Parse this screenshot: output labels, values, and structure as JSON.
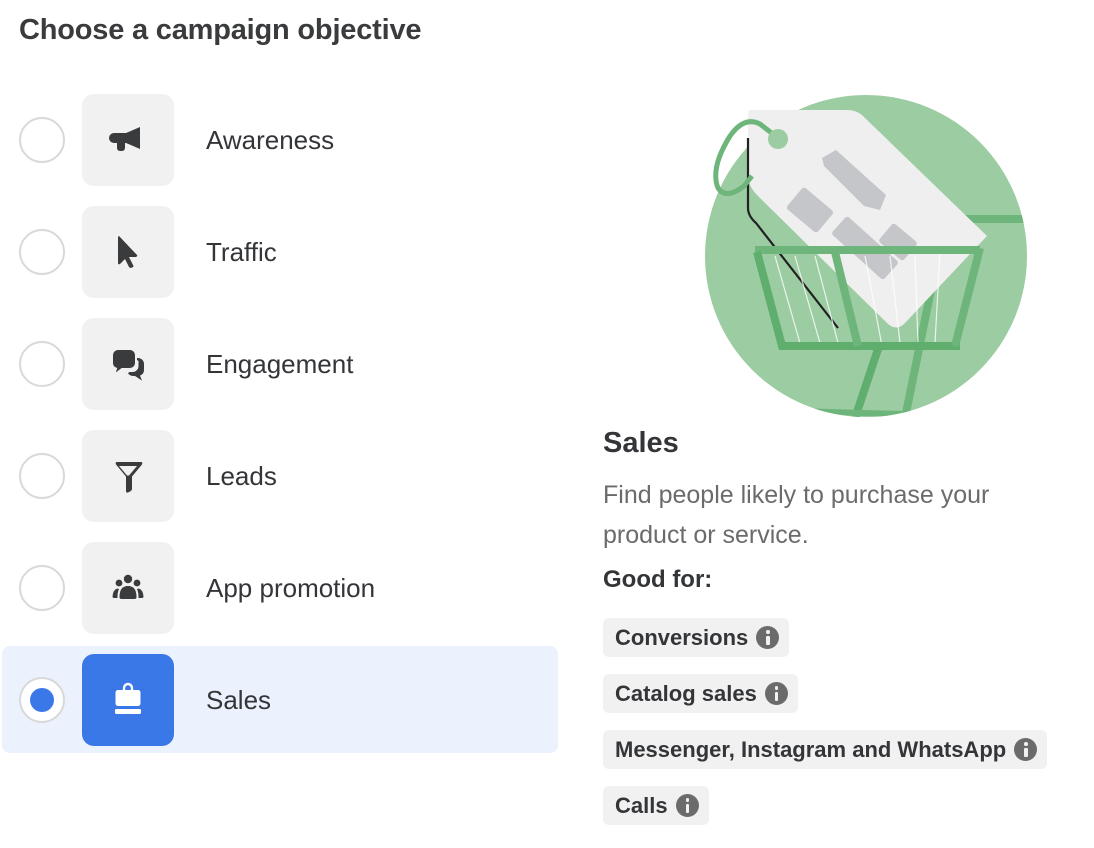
{
  "page": {
    "title": "Choose a campaign objective"
  },
  "objectives": [
    {
      "label": "Awareness",
      "icon": "megaphone-icon",
      "selected": false
    },
    {
      "label": "Traffic",
      "icon": "cursor-icon",
      "selected": false
    },
    {
      "label": "Engagement",
      "icon": "chat-bubbles-icon",
      "selected": false
    },
    {
      "label": "Leads",
      "icon": "funnel-icon",
      "selected": false
    },
    {
      "label": "App promotion",
      "icon": "people-icon",
      "selected": false
    },
    {
      "label": "Sales",
      "icon": "shopping-bag-icon",
      "selected": true
    }
  ],
  "detail": {
    "illustration": "shopping-cart-price-tag-illustration",
    "title": "Sales",
    "description": "Find people likely to purchase your product or service.",
    "good_for_label": "Good for:",
    "tags": [
      {
        "label": "Conversions",
        "icon": "info-icon"
      },
      {
        "label": "Catalog sales",
        "icon": "info-icon"
      },
      {
        "label": "Messenger, Instagram and WhatsApp",
        "icon": "info-icon"
      },
      {
        "label": "Calls",
        "icon": "info-icon"
      }
    ]
  },
  "colors": {
    "accent": "#3b78e7",
    "selected_row_bg": "#ebf2fd",
    "icon_box_bg": "#f1f1f1",
    "icon_color": "#3a3b3d",
    "illustration_green": "#9ccca2",
    "illustration_dark_green": "#5fae6e"
  }
}
